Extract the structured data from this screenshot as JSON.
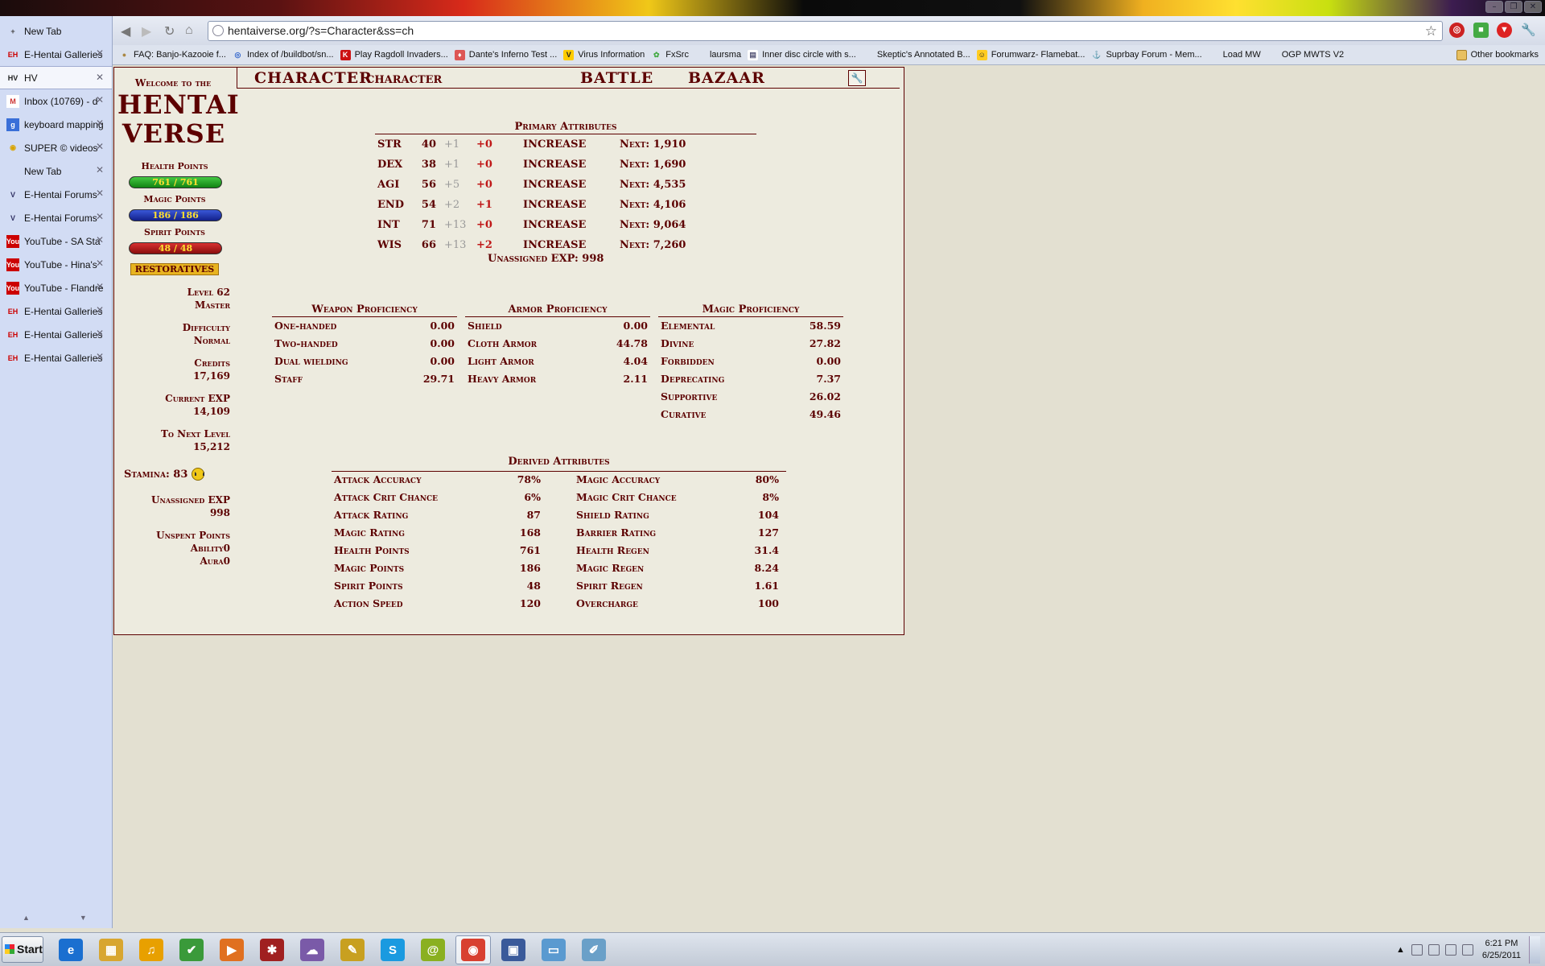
{
  "browser": {
    "url": "hentaiverse.org/?s=Character&ss=ch",
    "tabs": [
      {
        "label": "New Tab",
        "icon": "plus-icon",
        "active": false,
        "closable": false
      },
      {
        "label": "E-Hentai Galleries",
        "icon": "eh-icon",
        "active": false,
        "closable": true
      },
      {
        "label": "HV",
        "icon": "hv-icon",
        "active": true,
        "closable": true
      },
      {
        "label": "Inbox (10769) - d",
        "icon": "gmail-icon",
        "active": false,
        "closable": true
      },
      {
        "label": "keyboard mapping",
        "icon": "google-icon",
        "active": false,
        "closable": true
      },
      {
        "label": "SUPER © videos",
        "icon": "chrome-icon",
        "active": false,
        "closable": true
      },
      {
        "label": "New Tab",
        "icon": "blank-icon",
        "active": false,
        "closable": true
      },
      {
        "label": "E-Hentai Forums",
        "icon": "eh-forum-icon",
        "active": false,
        "closable": true
      },
      {
        "label": "E-Hentai Forums",
        "icon": "eh-forum-icon",
        "active": false,
        "closable": true
      },
      {
        "label": "YouTube - SA Sta",
        "icon": "youtube-icon",
        "active": false,
        "closable": true
      },
      {
        "label": "YouTube - Hina's",
        "icon": "youtube-icon",
        "active": false,
        "closable": true
      },
      {
        "label": "YouTube - Flandre",
        "icon": "youtube-icon",
        "active": false,
        "closable": true
      },
      {
        "label": "E-Hentai Galleries",
        "icon": "eh-icon",
        "active": false,
        "closable": true
      },
      {
        "label": "E-Hentai Galleries",
        "icon": "eh-icon",
        "active": false,
        "closable": true
      },
      {
        "label": "E-Hentai Galleries",
        "icon": "eh-icon",
        "active": false,
        "closable": true
      }
    ],
    "bookmarks": [
      {
        "label": "FAQ: Banjo-Kazooie f...",
        "icon": "forum-icon"
      },
      {
        "label": "Index of /buildbot/sn...",
        "icon": "chromium-icon"
      },
      {
        "label": "Play Ragdoll Invaders...",
        "icon": "k-icon"
      },
      {
        "label": "Dante's Inferno Test ...",
        "icon": "inferno-icon"
      },
      {
        "label": "Virus Information",
        "icon": "v-icon"
      },
      {
        "label": "FxSrc",
        "icon": "fx-icon"
      },
      {
        "label": "laursma",
        "icon": "blank-icon"
      },
      {
        "label": "Inner disc circle with s...",
        "icon": "page-icon"
      },
      {
        "label": "Skeptic's Annotated B...",
        "icon": "blank-icon"
      },
      {
        "label": "Forumwarz- Flamebat...",
        "icon": "smiley-icon"
      },
      {
        "label": "Suprbay Forum - Mem...",
        "icon": "suprbay-icon"
      },
      {
        "label": "Load MW",
        "icon": "blank-icon"
      },
      {
        "label": "OGP MWTS V2",
        "icon": "blank-icon"
      }
    ],
    "other_bookmarks": "Other bookmarks"
  },
  "game": {
    "welcome": "Welcome to the",
    "brand_line1": "HENTAI",
    "brand_line2": "VERSE",
    "health_label": "Health Points",
    "health_value": "761 / 761",
    "health_fraction": 1.0,
    "magic_label": "Magic Points",
    "magic_value": "186 / 186",
    "magic_fraction": 1.0,
    "spirit_label": "Spirit Points",
    "spirit_value": "48 / 48",
    "spirit_fraction": 1.0,
    "restoratives": "RESTORATIVES",
    "level_label": "Level 62",
    "level_title": "Master",
    "difficulty_label": "Difficulty",
    "difficulty_value": "Normal",
    "credits_label": "Credits",
    "credits_value": "17,169",
    "current_exp_label": "Current EXP",
    "current_exp_value": "14,109",
    "next_level_label": "To Next Level",
    "next_level_value": "15,212",
    "stamina_label": "Stamina: 83",
    "unassigned_exp_label": "Unassigned EXP",
    "unassigned_exp_value": "998",
    "unspent_label": "Unspent Points",
    "ability_label": "Ability",
    "ability_value": "0",
    "aura_label": "Aura",
    "aura_value": "0",
    "menu": {
      "character": "CHARACTER",
      "sub_character": "CHARACTER",
      "battle": "BATTLE",
      "bazaar": "BAZAAR"
    },
    "primary": {
      "title": "Primary Attributes",
      "increase_label": "INCREASE",
      "rows": [
        {
          "name": "STR",
          "base": "40",
          "equip": "+1",
          "bonus": "+0",
          "next": "Next: 1,910"
        },
        {
          "name": "DEX",
          "base": "38",
          "equip": "+1",
          "bonus": "+0",
          "next": "Next: 1,690"
        },
        {
          "name": "AGI",
          "base": "56",
          "equip": "+5",
          "bonus": "+0",
          "next": "Next: 4,535"
        },
        {
          "name": "END",
          "base": "54",
          "equip": "+2",
          "bonus": "+1",
          "next": "Next: 4,106"
        },
        {
          "name": "INT",
          "base": "71",
          "equip": "+13",
          "bonus": "+0",
          "next": "Next: 9,064"
        },
        {
          "name": "WIS",
          "base": "66",
          "equip": "+13",
          "bonus": "+2",
          "next": "Next: 7,260"
        }
      ],
      "unassigned": "Unassigned EXP: 998"
    },
    "weapon": {
      "title": "Weapon Proficiency",
      "rows": [
        {
          "name": "One-handed",
          "value": "0.00"
        },
        {
          "name": "Two-handed",
          "value": "0.00"
        },
        {
          "name": "Dual wielding",
          "value": "0.00"
        },
        {
          "name": "Staff",
          "value": "29.71"
        }
      ]
    },
    "armor": {
      "title": "Armor Proficiency",
      "rows": [
        {
          "name": "Shield",
          "value": "0.00"
        },
        {
          "name": "Cloth Armor",
          "value": "44.78"
        },
        {
          "name": "Light Armor",
          "value": "4.04"
        },
        {
          "name": "Heavy Armor",
          "value": "2.11"
        }
      ]
    },
    "magic": {
      "title": "Magic Proficiency",
      "rows": [
        {
          "name": "Elemental",
          "value": "58.59"
        },
        {
          "name": "Divine",
          "value": "27.82"
        },
        {
          "name": "Forbidden",
          "value": "0.00"
        },
        {
          "name": "Deprecating",
          "value": "7.37"
        },
        {
          "name": "Supportive",
          "value": "26.02"
        },
        {
          "name": "Curative",
          "value": "49.46"
        }
      ]
    },
    "derived": {
      "title": "Derived Attributes",
      "rows": [
        {
          "l_name": "Attack Accuracy",
          "l_value": "78%",
          "r_name": "Magic Accuracy",
          "r_value": "80%"
        },
        {
          "l_name": "Attack Crit Chance",
          "l_value": "6%",
          "r_name": "Magic Crit Chance",
          "r_value": "8%"
        },
        {
          "l_name": "Attack Rating",
          "l_value": "87",
          "r_name": "Shield Rating",
          "r_value": "104"
        },
        {
          "l_name": "Magic Rating",
          "l_value": "168",
          "r_name": "Barrier Rating",
          "r_value": "127"
        },
        {
          "l_name": "Health Points",
          "l_value": "761",
          "r_name": "Health Regen",
          "r_value": "31.4"
        },
        {
          "l_name": "Magic Points",
          "l_value": "186",
          "r_name": "Magic Regen",
          "r_value": "8.24"
        },
        {
          "l_name": "Spirit Points",
          "l_value": "48",
          "r_name": "Spirit Regen",
          "r_value": "1.61"
        },
        {
          "l_name": "Action Speed",
          "l_value": "120",
          "r_name": "Overcharge",
          "r_value": "100"
        }
      ]
    }
  },
  "taskbar": {
    "start": "Start",
    "apps": [
      "ie-icon",
      "explorer-icon",
      "winamp-icon",
      "pidgin-icon",
      "media-player-icon",
      "game-icon",
      "chat-icon",
      "paint-icon",
      "skype-icon",
      "mail-icon",
      "chrome-icon",
      "video-editor-icon",
      "notepad-icon",
      "paint-brush-icon"
    ],
    "active_app": "chrome-icon",
    "time": "6:21 PM",
    "date": "6/25/2011"
  },
  "colors": {
    "game_red": "#5c0000",
    "health": "#1ea11e",
    "magic": "#1c3bb0",
    "spirit": "#b01010"
  }
}
